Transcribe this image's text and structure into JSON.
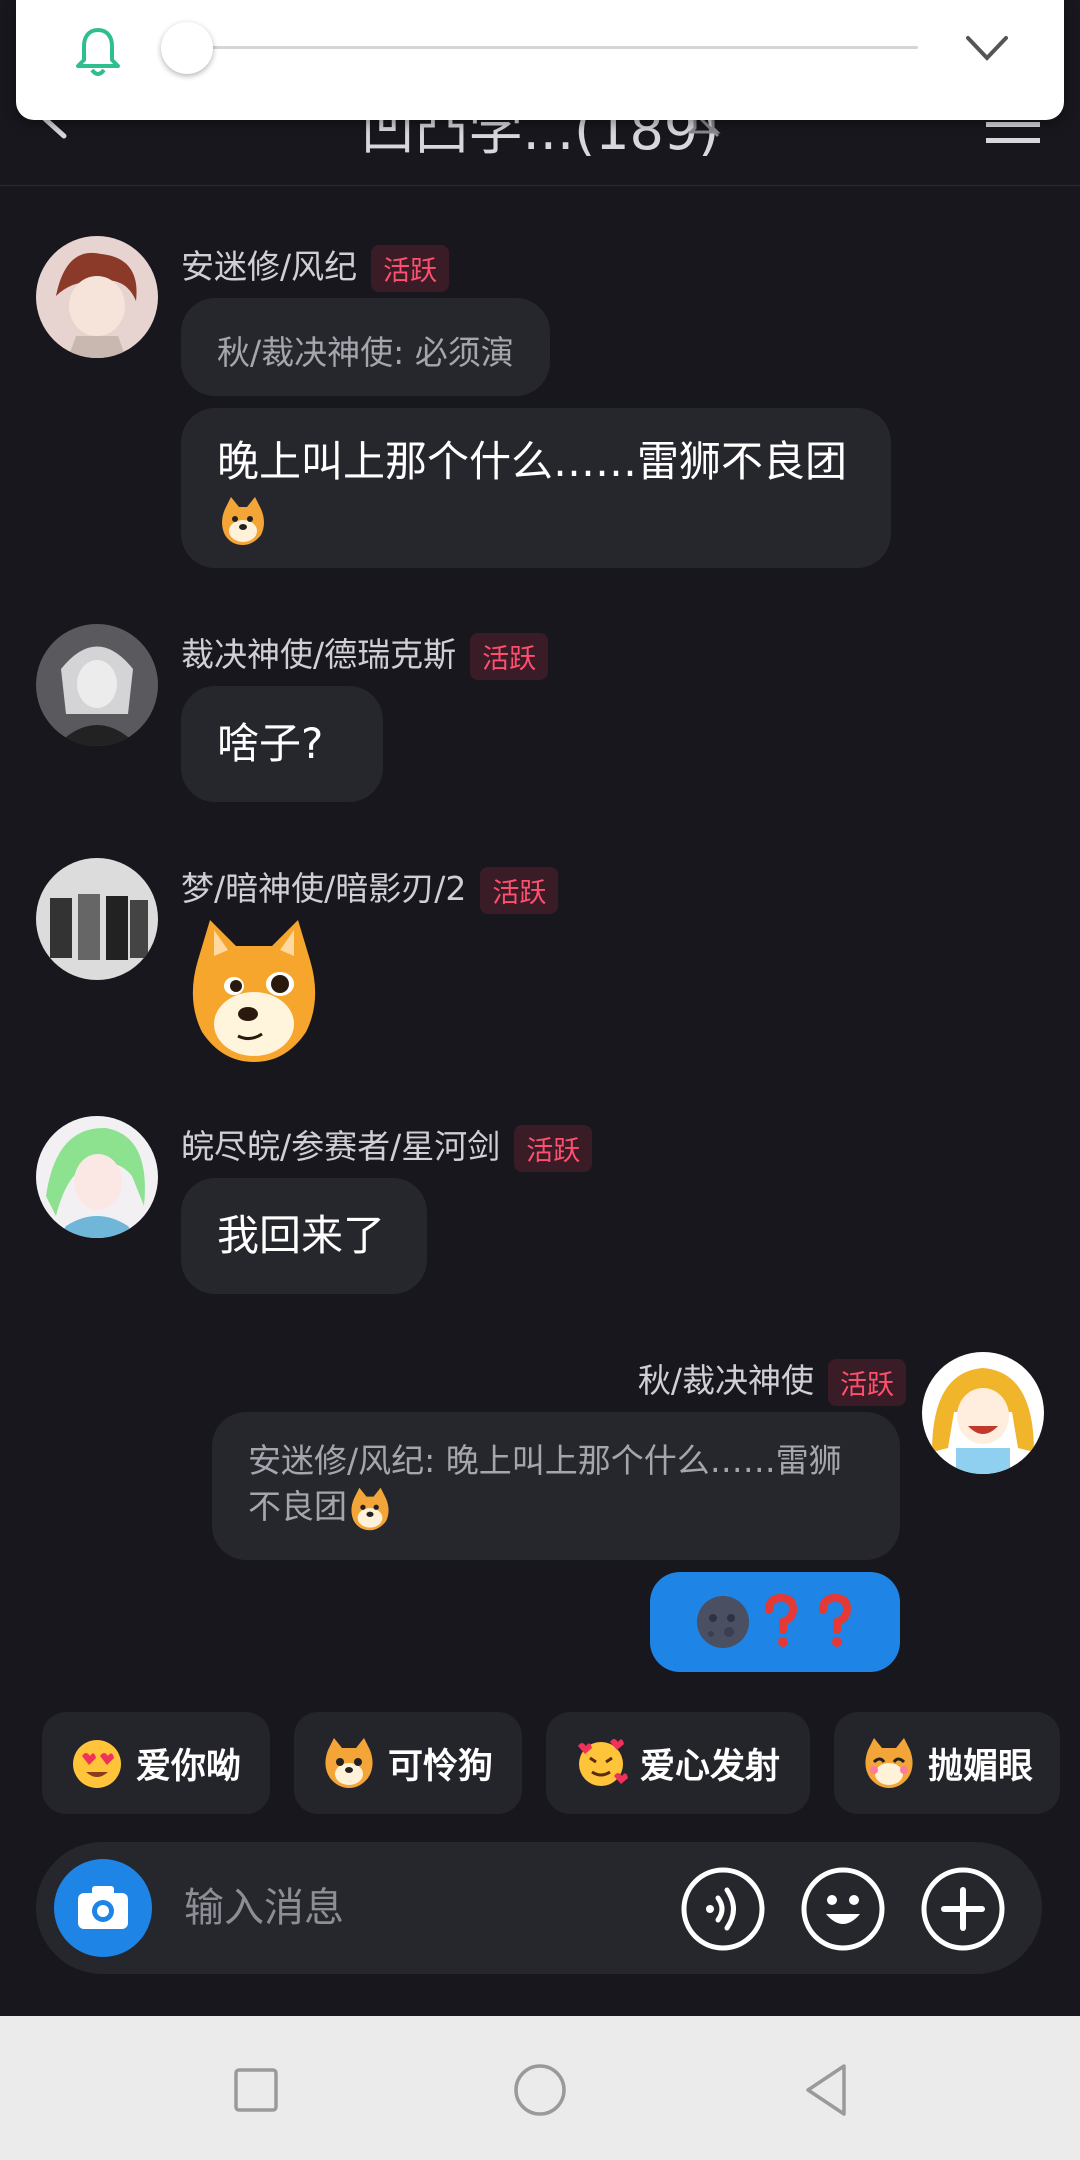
{
  "header": {
    "title": "凹凸学...(189)"
  },
  "volume_popup": {
    "level": 0.0
  },
  "messages": [
    {
      "user": "安迷修/风纪",
      "badge": "活跃",
      "quote": "秋/裁决神使: 必须演",
      "text": "晚上叫上那个什么……雷狮不良团",
      "emoji": "doge"
    },
    {
      "user": "裁决神使/德瑞克斯",
      "badge": "活跃",
      "text": "啥子?"
    },
    {
      "user": "梦/暗神使/暗影刃/2",
      "badge": "活跃",
      "sticker": "doge"
    },
    {
      "user": "皖尽皖/参赛者/星河剑",
      "badge": "活跃",
      "text": "我回来了"
    },
    {
      "user": "秋/裁决神使",
      "badge": "活跃",
      "quote": "安迷修/风纪: 晚上叫上那个什么……雷狮不良团",
      "own_message": "🌚❓❓"
    }
  ],
  "quick_reactions": [
    "爱你呦",
    "可怜狗",
    "爱心发射",
    "抛媚眼"
  ],
  "composer": {
    "placeholder": "输入消息"
  },
  "colors": {
    "background": "#17171d",
    "bubble": "#26262d",
    "accent": "#1e84e6",
    "badge_text": "#ff4f6e",
    "badge_bg": "#3a1c27",
    "bell_green": "#2fbf8f"
  },
  "icons": [
    "bell-icon",
    "chevron-down-icon",
    "back-arrow-icon",
    "bell-muted-icon",
    "menu-icon",
    "camera-icon",
    "voice-icon",
    "emoji-icon",
    "plus-icon",
    "square-nav-icon",
    "circle-nav-icon",
    "triangle-back-nav-icon"
  ]
}
